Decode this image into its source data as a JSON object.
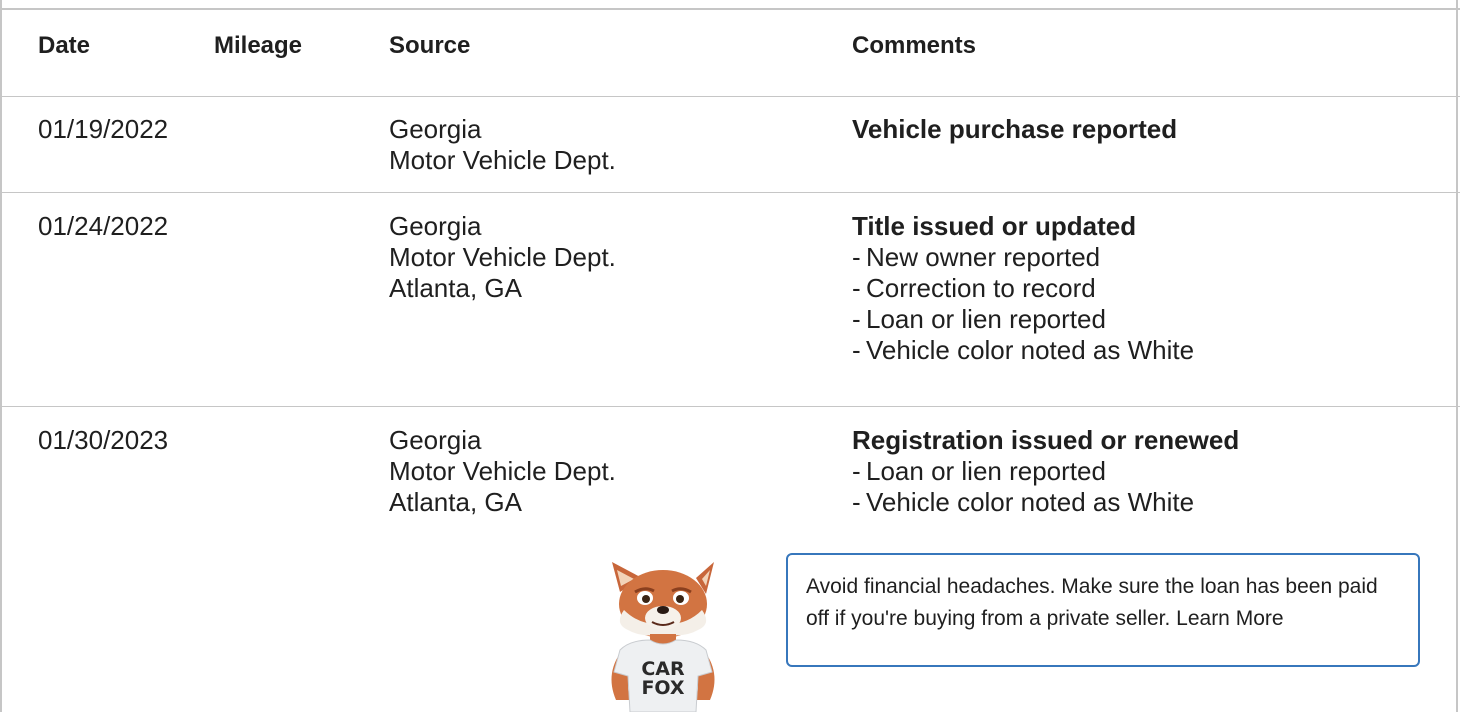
{
  "columns": [
    "Date",
    "Mileage",
    "Source",
    "Comments"
  ],
  "records": [
    {
      "date": "01/19/2022",
      "source": [
        "Georgia",
        "Motor Vehicle Dept."
      ],
      "comment_title": "Vehicle purchase reported",
      "comment_items": []
    },
    {
      "date": "01/24/2022",
      "source": [
        "Georgia",
        "Motor Vehicle Dept.",
        "Atlanta, GA"
      ],
      "comment_title": "Title issued or updated",
      "comment_items": [
        "New owner reported",
        "Correction to record",
        "Loan or lien reported",
        "Vehicle color noted as White"
      ]
    },
    {
      "date": "01/30/2023",
      "source": [
        "Georgia",
        "Motor Vehicle Dept.",
        "Atlanta, GA"
      ],
      "comment_title": "Registration issued or renewed",
      "comment_items": [
        "Loan or lien reported",
        "Vehicle color noted as White"
      ]
    }
  ],
  "tip": {
    "text": "Avoid financial headaches. Make sure the loan has been paid off if you're buying from a private seller.",
    "link": "Learn More",
    "shirt_line1": "CAR",
    "shirt_line2": "FOX"
  },
  "colors": {
    "border": "#c6c6c6",
    "tip_border": "#3777bc",
    "text": "#1f1f1f"
  },
  "icons": {
    "mascot": "carfox-mascot-icon"
  }
}
